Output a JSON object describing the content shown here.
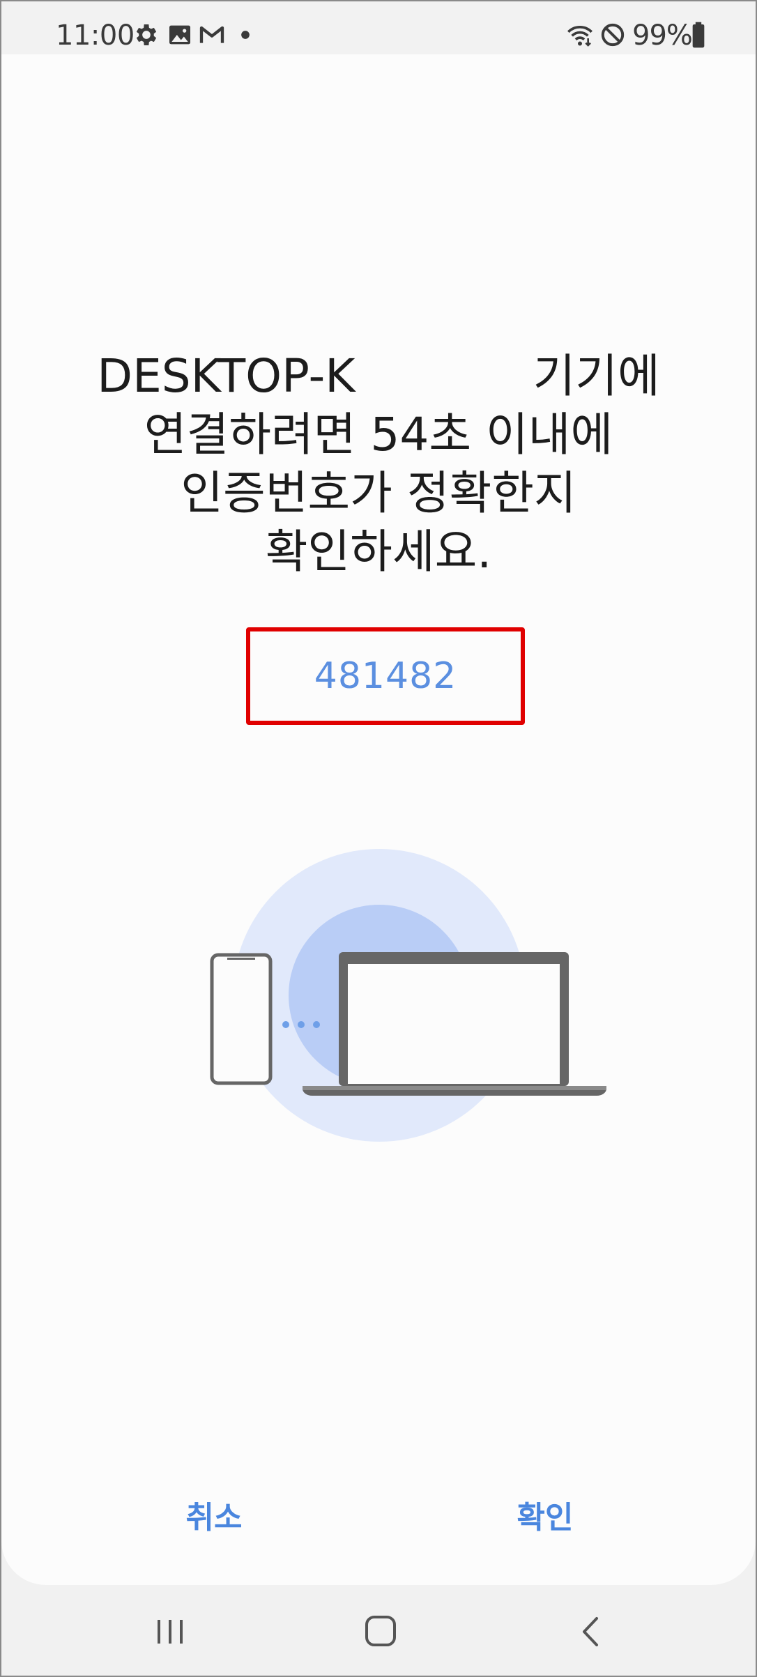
{
  "status_bar": {
    "time": "11:00",
    "icons": [
      "gear-icon",
      "gallery-icon",
      "gmail-icon",
      "dot-icon",
      "wifi-icon",
      "do-not-disturb-icon",
      "battery-icon"
    ],
    "battery_text": "99%"
  },
  "dialog": {
    "message_line1_start": "DESKTOP-K",
    "message_line1_end": "기기에",
    "message_line2": "연결하려면 54초 이내에",
    "message_line3": "인증번호가 정확한지",
    "message_line4": "확인하세요.",
    "code": "481482",
    "cancel_label": "취소",
    "ok_label": "확인"
  },
  "illustration": {
    "icons": [
      "phone-icon",
      "laptop-icon",
      "connection-dots-icon"
    ],
    "colors": {
      "outer_circle": "#e1e9fb",
      "inner_circle": "#b9cdf6",
      "device": "#666666",
      "dots": "#6e9fe8"
    }
  },
  "nav_bar": {
    "icons": [
      "recents-icon",
      "home-icon",
      "back-icon"
    ]
  },
  "colors": {
    "accent": "#4a86de",
    "code_text": "#5b8fe0",
    "highlight_border": "#e00000"
  }
}
